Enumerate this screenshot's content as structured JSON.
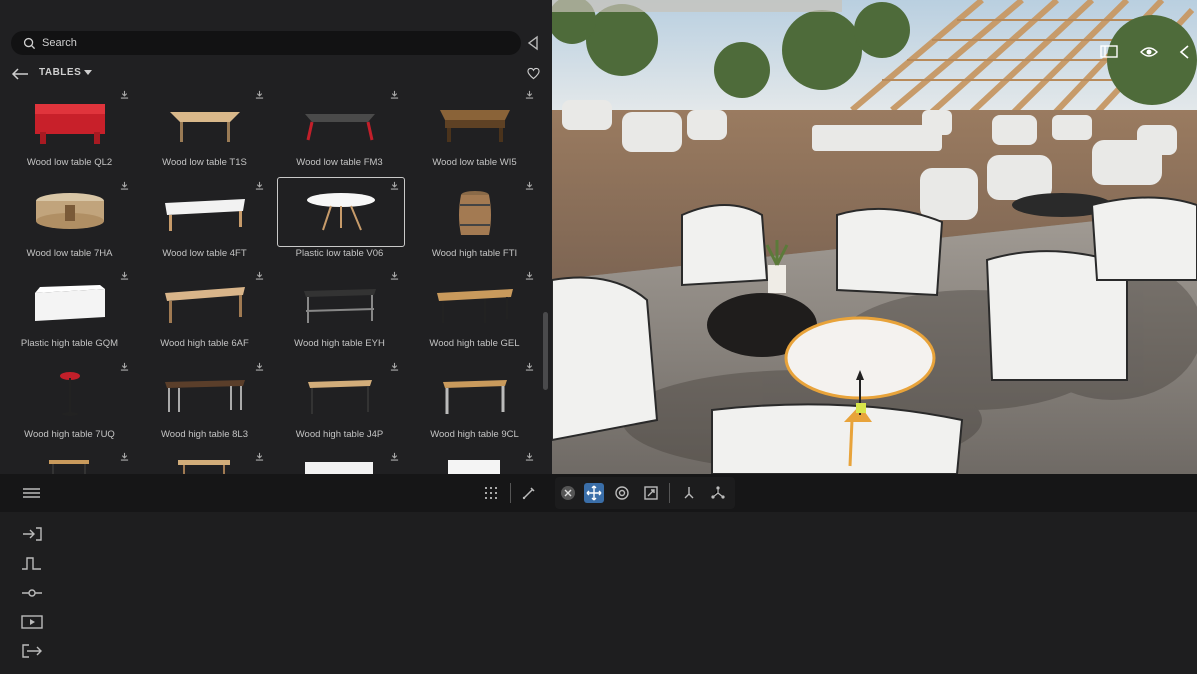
{
  "search": {
    "placeholder": "Search"
  },
  "nav": {
    "category": "TABLES"
  },
  "assets": [
    {
      "label": "Wood low table QL2",
      "icon": "red-low-table"
    },
    {
      "label": "Wood low table T1S",
      "icon": "wood-low-table"
    },
    {
      "label": "Wood low table FM3",
      "icon": "glass-low-table"
    },
    {
      "label": "Wood low table WI5",
      "icon": "dark-wood-low-table"
    },
    {
      "label": "Wood low table 7HA",
      "icon": "round-wood-low-table"
    },
    {
      "label": "Wood low table 4FT",
      "icon": "white-low-table"
    },
    {
      "label": "Plastic low table V06",
      "icon": "oval-white-table",
      "selected": true
    },
    {
      "label": "Wood high table FTI",
      "icon": "barrel-table"
    },
    {
      "label": "Plastic high table GQM",
      "icon": "white-block-table"
    },
    {
      "label": "Wood high table 6AF",
      "icon": "wood-high-table"
    },
    {
      "label": "Wood high table EYH",
      "icon": "black-frame-table"
    },
    {
      "label": "Wood high table GEL",
      "icon": "wood-top-black-table"
    },
    {
      "label": "Wood high table 7UQ",
      "icon": "red-round-bar-table"
    },
    {
      "label": "Wood high table 8L3",
      "icon": "console-table"
    },
    {
      "label": "Wood high table J4P",
      "icon": "wood-high-table-2"
    },
    {
      "label": "Wood high table 9CL",
      "icon": "wood-steel-table"
    }
  ],
  "toolbar": {
    "tools": [
      "menu-icon",
      "grid-icon",
      "eyedropper-icon",
      "cancel-icon",
      "move-icon",
      "rotate-icon",
      "scale-icon",
      "pivot-icon",
      "node-transform-icon"
    ],
    "active_tool": "move-icon"
  },
  "viewport_icons": [
    "panel-icon",
    "eye-icon",
    "collapse-chevron-icon"
  ],
  "side_icons": [
    "enter-icon",
    "step-curve-icon",
    "slider-icon",
    "play-icon",
    "exit-icon"
  ],
  "colors": {
    "accent": "#3a6ea8",
    "selection": "#e8a33a",
    "panel": "#202022",
    "background": "#1e1e1f"
  }
}
